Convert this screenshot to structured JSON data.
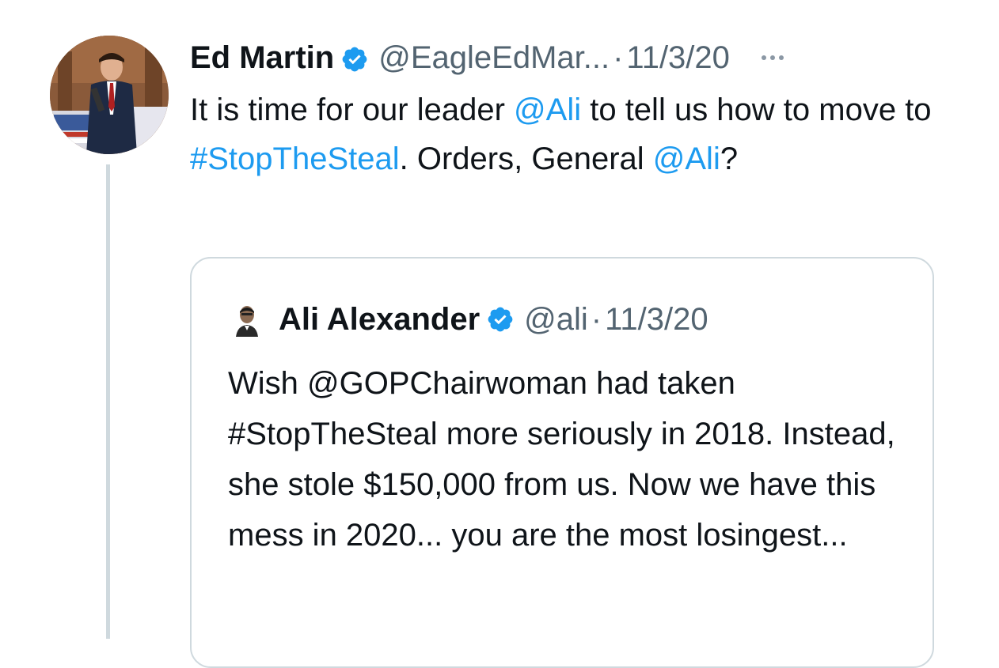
{
  "tweet": {
    "author_name": "Ed Martin",
    "handle": "@EagleEdMar...",
    "separator": "·",
    "date": "11/3/20",
    "body": {
      "t1": "It is time for our leader ",
      "m1": "@Ali",
      "t2": " to tell us how to move to ",
      "h1": "#StopTheSteal",
      "t3": ".  Orders, General ",
      "m2": "@Ali",
      "t4": "?"
    }
  },
  "quoted_tweet": {
    "author_name": "Ali Alexander",
    "handle": "@ali",
    "separator": "·",
    "date": "11/3/20",
    "text": "Wish @GOPChairwoman had taken #StopTheSteal more seriously in 2018. Instead, she stole $150,000 from us. Now we have this mess in 2020... you are the most losingest..."
  },
  "icons": {
    "verified": "verified-badge-icon",
    "more": "more-options-icon"
  },
  "colors": {
    "link": "#1d9bf0",
    "secondary_text": "#536471",
    "border": "#cfd9de",
    "verified": "#1d9bf0"
  }
}
